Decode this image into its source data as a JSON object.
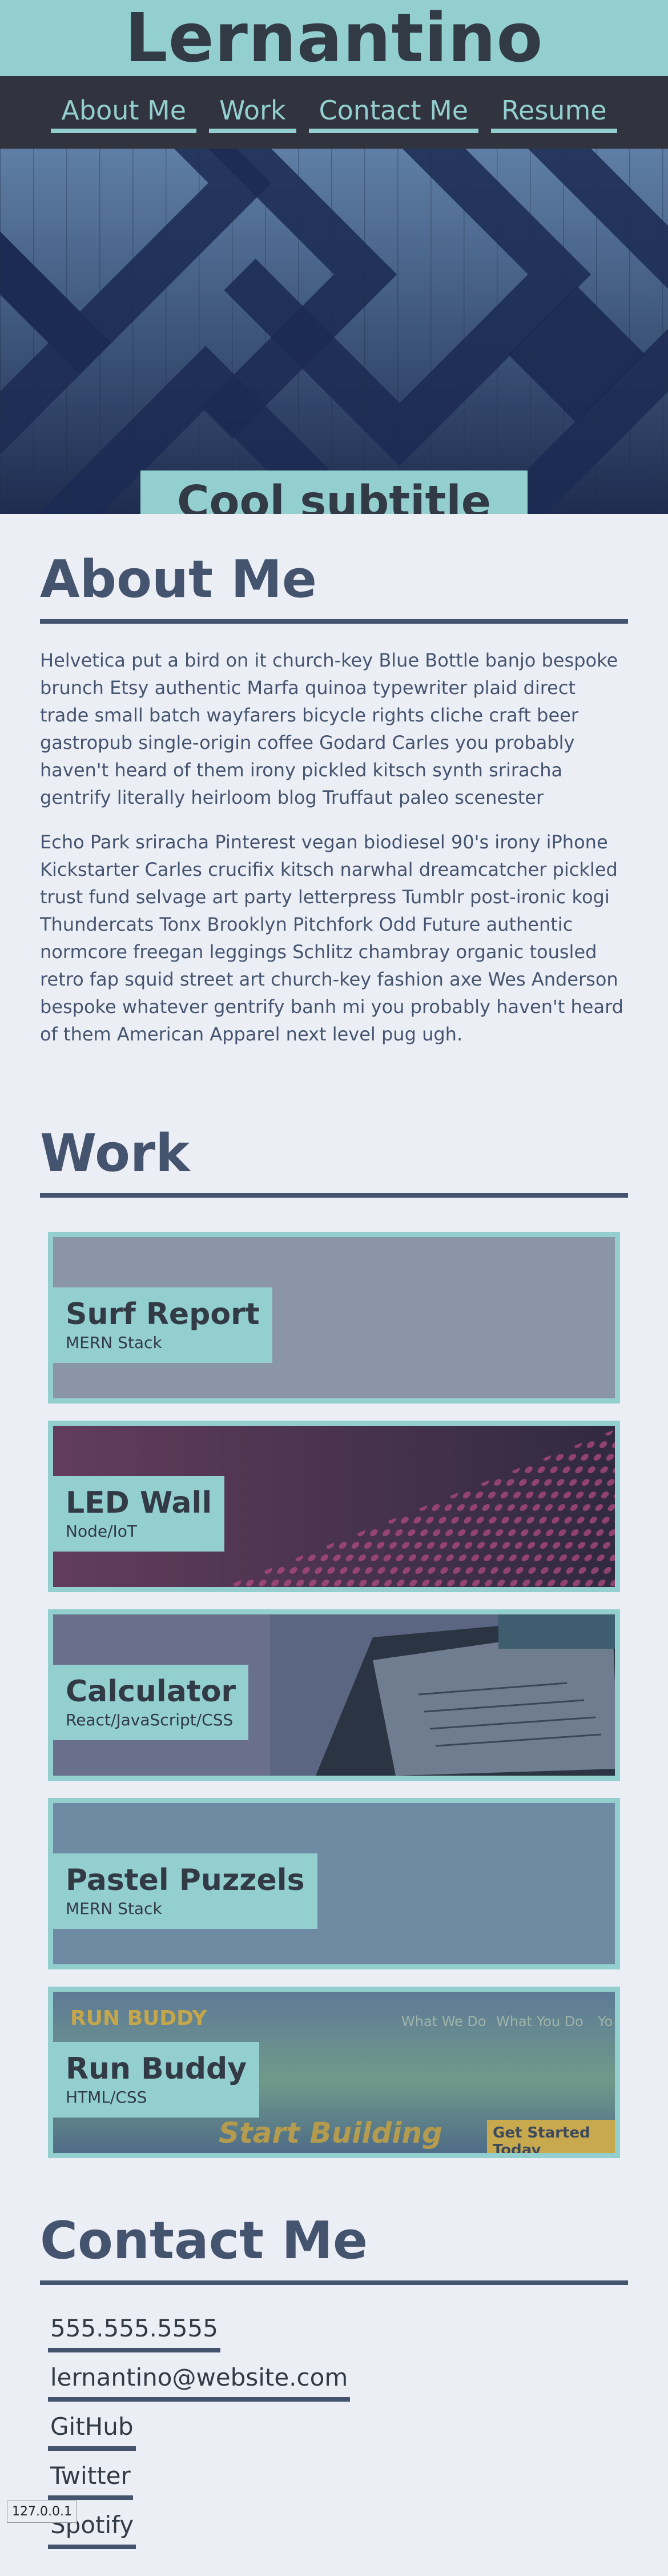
{
  "header": {
    "site_title": "Lernantino"
  },
  "nav": [
    "About Me",
    "Work",
    "Contact Me",
    "Resume"
  ],
  "hero": {
    "subtitle": "Cool subtitle here!"
  },
  "about": {
    "title": "About Me",
    "paragraphs": [
      "Helvetica put a bird on it church-key Blue Bottle banjo bespoke brunch Etsy authentic Marfa quinoa typewriter plaid direct trade small batch wayfarers bicycle rights cliche craft beer gastropub single-origin coffee Godard Carles you probably haven't heard of them irony pickled kitsch synth sriracha gentrify literally heirloom blog Truffaut paleo scenester",
      "Echo Park sriracha Pinterest vegan biodiesel 90's irony iPhone Kickstarter Carles crucifix kitsch narwhal dreamcatcher pickled trust fund selvage art party letterpress Tumblr post-ironic kogi Thundercats Tonx Brooklyn Pitchfork Odd Future authentic normcore freegan leggings Schlitz chambray organic tousled retro fap squid street art church-key fashion axe Wes Anderson bespoke whatever gentrify banh mi you probably haven't heard of them American Apparel next level pug ugh."
    ]
  },
  "work": {
    "title": "Work",
    "projects": [
      {
        "title": "Surf Report",
        "stack": "MERN Stack"
      },
      {
        "title": "LED Wall",
        "stack": "Node/IoT"
      },
      {
        "title": "Calculator",
        "stack": "React/JavaScript/CSS"
      },
      {
        "title": "Pastel Puzzels",
        "stack": "MERN Stack"
      },
      {
        "title": "Run Buddy",
        "stack": "HTML/CSS",
        "thumbnail_text": {
          "brand": "RUN BUDDY",
          "nav": [
            "What We Do",
            "What You Do",
            "Yo"
          ],
          "tagline": "Start Building",
          "cta": "Get Started Today"
        }
      }
    ]
  },
  "contact": {
    "title": "Contact Me",
    "links": [
      "555.555.5555",
      "lernantino@website.com",
      "GitHub",
      "Twitter",
      "Spotify"
    ]
  },
  "status_bar": {
    "url": "127.0.0.1"
  },
  "colors": {
    "teal": "#94cfcf",
    "dark": "#313a45",
    "slate": "#45546e",
    "page_bg": "#eceef6"
  }
}
